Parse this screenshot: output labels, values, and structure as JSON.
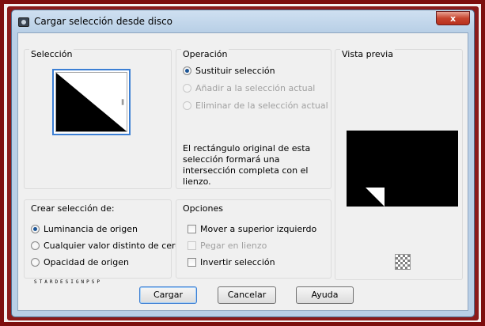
{
  "window": {
    "title": "Cargar selección desde disco",
    "close_label": "x"
  },
  "seleccion": {
    "title": "Selección"
  },
  "operacion": {
    "title": "Operación",
    "options": [
      {
        "label": "Sustituir selección",
        "checked": true,
        "disabled": false
      },
      {
        "label": "Añadir a la selección actual",
        "checked": false,
        "disabled": true
      },
      {
        "label": "Eliminar de la selección actual",
        "checked": false,
        "disabled": true
      }
    ],
    "description": "El rectángulo original de esta selección formará una intersección completa con el lienzo."
  },
  "vista_previa": {
    "title": "Vista previa",
    "icon": "checker-pattern-icon"
  },
  "crear": {
    "title": "Crear selección de:",
    "options": [
      {
        "label": "Luminancia de origen",
        "checked": true
      },
      {
        "label": "Cualquier valor distinto de cero",
        "checked": false
      },
      {
        "label": "Opacidad de origen",
        "checked": false
      }
    ]
  },
  "opciones": {
    "title": "Opciones",
    "items": [
      {
        "label": "Mover a superior izquierdo",
        "checked": false,
        "disabled": false
      },
      {
        "label": "Pegar en lienzo",
        "checked": false,
        "disabled": true
      },
      {
        "label": "Invertir selección",
        "checked": false,
        "disabled": false
      }
    ]
  },
  "watermark": "STARDESIGNPSP",
  "buttons": {
    "load": "Cargar",
    "cancel": "Cancelar",
    "help": "Ayuda"
  },
  "colors": {
    "frame": "#7d0e0e",
    "accent": "#3c7fd4",
    "title_bar": "#b9cfe6"
  }
}
